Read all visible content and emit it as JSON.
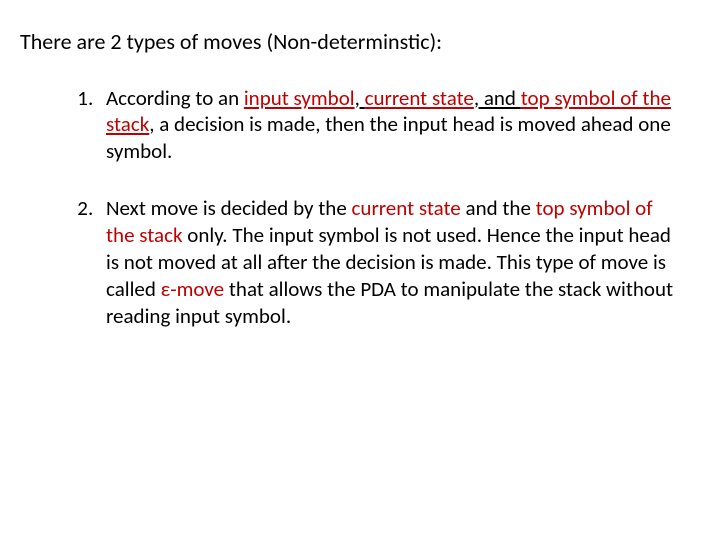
{
  "title": "There are  2 types of moves (Non-determinstic):",
  "items": [
    {
      "num": "1.",
      "pre": "According to an ",
      "hl1": "input symbol",
      "mid1": ", ",
      "hl2": "current state",
      "mid2": ", and ",
      "hl3": "top symbol of the stack",
      "post": ", a decision is made, then the input head is moved ahead one symbol."
    },
    {
      "num": "2.",
      "pre": "Next move is decided by the ",
      "hl1": "current state",
      "mid1": " and the ",
      "hl2": "top symbol of the stack",
      "mid2": " only.  The input symbol is not used. Hence the input head is not moved at all after the decision is made. This type of move is called ",
      "eps": "ε-move",
      "post": " that allows the PDA to manipulate the stack without reading input symbol."
    }
  ]
}
